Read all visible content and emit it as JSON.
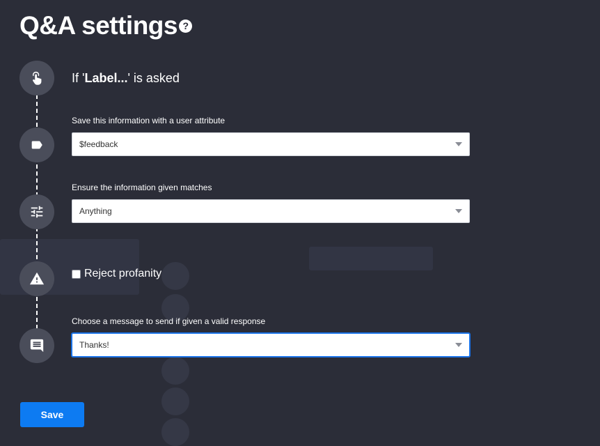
{
  "title": "Q&A settings",
  "help_glyph": "?",
  "question": {
    "prefix": "If '",
    "label": "Label...",
    "suffix": "' is asked"
  },
  "attribute": {
    "label": "Save this information with a user attribute",
    "value": "$feedback"
  },
  "validation": {
    "label": "Ensure the information given matches",
    "value": "Anything"
  },
  "profanity": {
    "label": "Reject profanity",
    "checked": false
  },
  "response": {
    "label": "Choose a message to send if given a valid response",
    "value": "Thanks!"
  },
  "save_label": "Save",
  "icons": [
    "pointer-hand-icon",
    "tag-icon",
    "sliders-icon",
    "warning-icon",
    "chat-bubble-icon"
  ],
  "colors": {
    "background": "#2b2d38",
    "step_icon": "#4a4d5a",
    "primary_button": "#0d7bf2",
    "focus_border": "#1a73e8"
  }
}
